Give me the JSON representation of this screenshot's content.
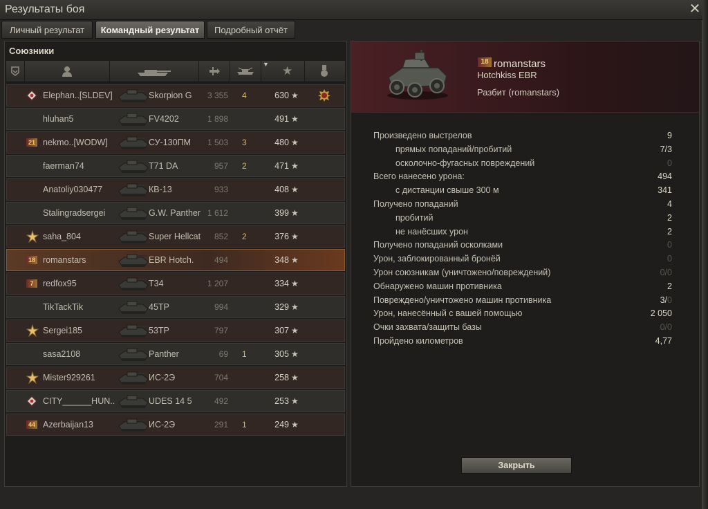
{
  "window": {
    "title": "Результаты боя"
  },
  "tabs": [
    {
      "label": "Личный результат",
      "active": false
    },
    {
      "label": "Командный результат",
      "active": true
    },
    {
      "label": "Подробный отчёт",
      "active": false
    }
  ],
  "allies": {
    "title": "Союзники",
    "rows": [
      {
        "nick": "Elephan..[SLDEV]",
        "tank": "Skorpion G",
        "damage": "3 355",
        "kills": "4",
        "xp": "630",
        "badge": "diamond",
        "medal": true
      },
      {
        "nick": "hluhan5",
        "tank": "FV4202",
        "damage": "1 898",
        "kills": "",
        "xp": "491"
      },
      {
        "nick": "nekmo..[WODW]",
        "tank": "СУ-130ПМ",
        "damage": "1 503",
        "kills": "3",
        "xp": "480",
        "rank": "21"
      },
      {
        "nick": "faerman74",
        "tank": "T71 DA",
        "damage": "957",
        "kills": "2",
        "xp": "471"
      },
      {
        "nick": "Anatoliy030477",
        "tank": "КВ-13",
        "damage": "933",
        "kills": "",
        "xp": "408"
      },
      {
        "nick": "Stalingradsergei",
        "tank": "G.W. Panther",
        "damage": "1 612",
        "kills": "",
        "xp": "399"
      },
      {
        "nick": "saha_804",
        "tank": "Super Hellcat",
        "damage": "852",
        "kills": "2",
        "xp": "376",
        "badge": "star"
      },
      {
        "nick": "romanstars",
        "tank": "EBR Hotch.",
        "damage": "494",
        "kills": "",
        "xp": "348",
        "rank": "18",
        "selected": true
      },
      {
        "nick": "redfox95",
        "tank": "T34",
        "damage": "1 207",
        "kills": "",
        "xp": "334",
        "rank": "7"
      },
      {
        "nick": "TikTackTik",
        "tank": "45TP",
        "damage": "994",
        "kills": "",
        "xp": "329"
      },
      {
        "nick": "Sergei185",
        "tank": "53TP",
        "damage": "797",
        "kills": "",
        "xp": "307",
        "badge": "star"
      },
      {
        "nick": "sasa2108",
        "tank": "Panther",
        "damage": "69",
        "kills": "1",
        "xp": "305"
      },
      {
        "nick": "Mister929261",
        "tank": "ИС-2Э",
        "damage": "704",
        "kills": "",
        "xp": "258",
        "badge": "star"
      },
      {
        "nick": "CITY______HUN..",
        "tank": "UDES 14 5",
        "damage": "492",
        "kills": "",
        "xp": "253",
        "badge": "diamond"
      },
      {
        "nick": "Azerbaijan13",
        "tank": "ИС-2Э",
        "damage": "291",
        "kills": "1",
        "xp": "249",
        "rank": "44"
      }
    ]
  },
  "player": {
    "rank": "18",
    "name": "romanstars",
    "tank": "Hotchkiss EBR",
    "status": "Разбит (romanstars)"
  },
  "stats": [
    {
      "label": "Произведено выстрелов",
      "value": "9"
    },
    {
      "label": "прямых попаданий/пробитий",
      "value": "7/3",
      "sub": true
    },
    {
      "label": "осколочно-фугасных повреждений",
      "value": "0",
      "sub": true,
      "dim": true
    },
    {
      "label": "Всего нанесено урона:",
      "value": "494"
    },
    {
      "label": "с дистанции свыше 300 м",
      "value": "341",
      "sub": true
    },
    {
      "label": "Получено попаданий",
      "value": "4"
    },
    {
      "label": "пробитий",
      "value": "2",
      "sub": true
    },
    {
      "label": "не нанёсших урон",
      "value": "2",
      "sub": true
    },
    {
      "label": "Получено попаданий осколками",
      "value": "0",
      "dim": true
    },
    {
      "label": "Урон, заблокированный бронёй",
      "value": "0",
      "dim": true
    },
    {
      "label": "Урон союзникам (уничтожено/повреждений)",
      "value": "0/0",
      "dim": true
    },
    {
      "label": "Обнаружено машин противника",
      "value": "2"
    },
    {
      "label": "Повреждено/уничтожено машин противника",
      "value": "3/",
      "value_dim": "0"
    },
    {
      "label": "Урон, нанесённый с вашей помощью",
      "value": "2 050"
    },
    {
      "label": "Очки захвата/защиты базы",
      "value": "0/0",
      "dim": true
    },
    {
      "label": "Пройдено километров",
      "value": "4,77"
    }
  ],
  "close_button": "Закрыть",
  "star_glyph": "★"
}
